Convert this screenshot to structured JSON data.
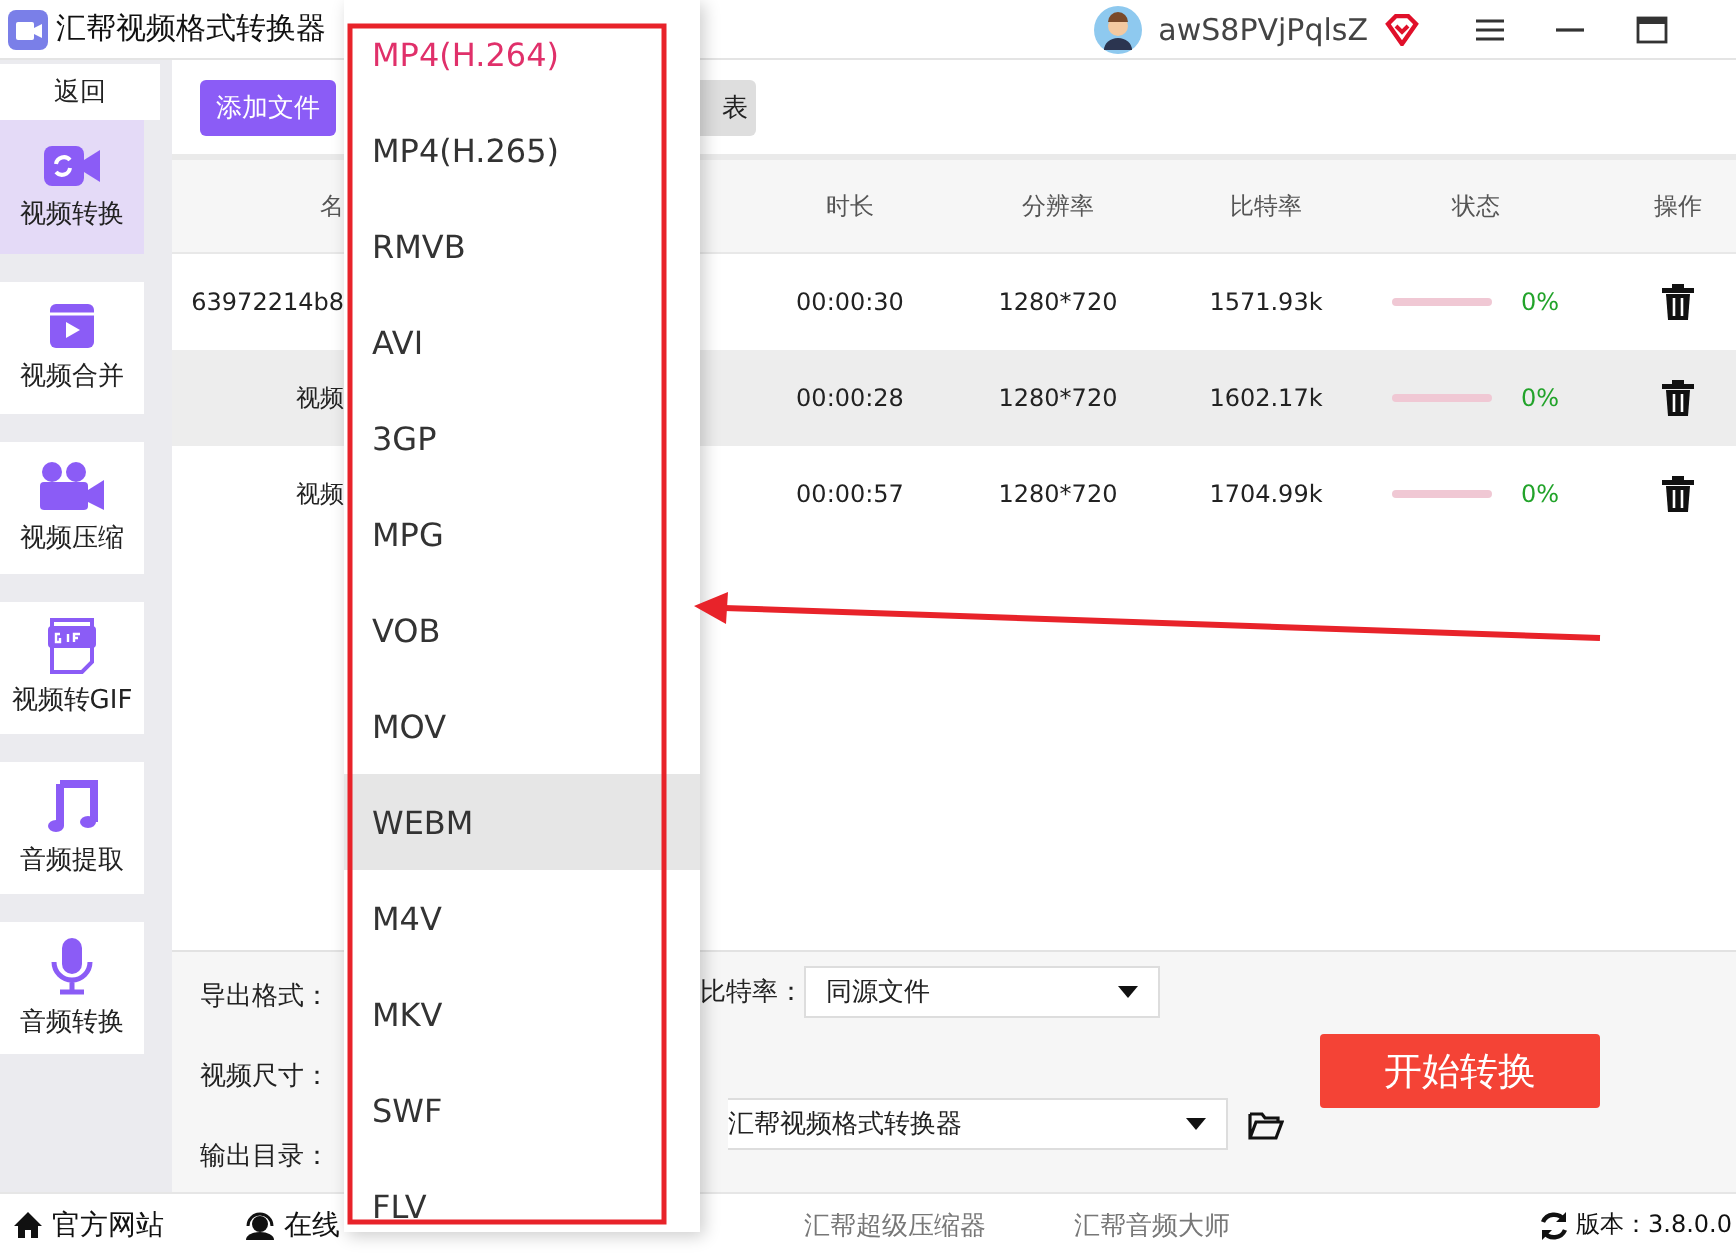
{
  "window": {
    "title": "汇帮视频格式转换器",
    "user": "awS8PVjPqlsZ"
  },
  "sidebar": {
    "back": "返回",
    "items": [
      {
        "label": "视频转换",
        "kind": "convert",
        "selected": true
      },
      {
        "label": "视频合并",
        "kind": "merge",
        "selected": false
      },
      {
        "label": "视频压缩",
        "kind": "camera",
        "selected": false
      },
      {
        "label": "视频转GIF",
        "kind": "gif",
        "selected": false
      },
      {
        "label": "音频提取",
        "kind": "music",
        "selected": false
      },
      {
        "label": "音频转换",
        "kind": "mic",
        "selected": false
      }
    ]
  },
  "toolbar": {
    "buttons": [
      {
        "label": "添加文件",
        "kind": "primary"
      },
      {
        "label": "表",
        "kind": "secondary"
      }
    ]
  },
  "table": {
    "columns": [
      "名",
      "时长",
      "分辨率",
      "比特率",
      "状态",
      "操作"
    ],
    "rows": [
      {
        "name": "63972214b8",
        "duration": "00:00:30",
        "resolution": "1280*720",
        "bitrate": "1571.93k",
        "progress": {
          "level": 0
        },
        "status": "0%",
        "highlighted": false
      },
      {
        "name": "视频",
        "duration": "00:00:28",
        "resolution": "1280*720",
        "bitrate": "1602.17k",
        "progress": {
          "level": 0
        },
        "status": "0%",
        "highlighted": true
      },
      {
        "name": "视频",
        "duration": "00:00:57",
        "resolution": "1280*720",
        "bitrate": "1704.99k",
        "progress": {
          "level": 0
        },
        "status": "0%",
        "highlighted": false
      }
    ]
  },
  "settings": {
    "format_label": "导出格式：",
    "size_label": "视频尺寸：",
    "bitrate_label": "比特率：",
    "bitrate_value": "同源文件",
    "output_label": "输出目录：",
    "output_value": "汇帮视频格式转换器",
    "start": "开始转换"
  },
  "format_menu": {
    "items": [
      {
        "label": "MP4(H.264)",
        "selected": true,
        "hovered": false
      },
      {
        "label": "MP4(H.265)",
        "selected": false,
        "hovered": false
      },
      {
        "label": "RMVB",
        "selected": false,
        "hovered": false
      },
      {
        "label": "AVI",
        "selected": false,
        "hovered": false
      },
      {
        "label": "3GP",
        "selected": false,
        "hovered": false
      },
      {
        "label": "MPG",
        "selected": false,
        "hovered": false
      },
      {
        "label": "VOB",
        "selected": false,
        "hovered": false
      },
      {
        "label": "MOV",
        "selected": false,
        "hovered": false
      },
      {
        "label": "WEBM",
        "selected": false,
        "hovered": true
      },
      {
        "label": "M4V",
        "selected": false,
        "hovered": false
      },
      {
        "label": "MKV",
        "selected": false,
        "hovered": false
      },
      {
        "label": "SWF",
        "selected": false,
        "hovered": false
      },
      {
        "label": "FLV",
        "selected": false,
        "hovered": false
      }
    ]
  },
  "footer": {
    "links": [
      {
        "label": "官方网站",
        "kind": "home"
      },
      {
        "label": "在线",
        "kind": "support"
      },
      {
        "label": "汇帮超级压缩器",
        "kind": "plain"
      },
      {
        "label": "汇帮音频大师",
        "kind": "plain"
      }
    ],
    "version": "版本：3.8.0.0"
  }
}
